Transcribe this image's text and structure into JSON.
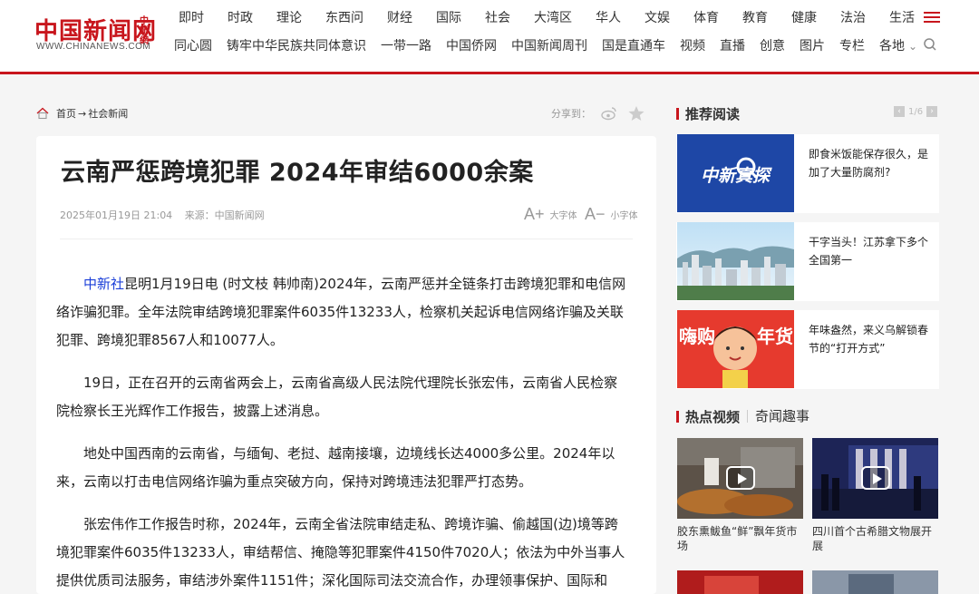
{
  "logo": {
    "main": "中国新闻网",
    "small": "中新網",
    "url": "WWW.CHINANEWS.COM"
  },
  "nav": {
    "row1": [
      "即时",
      "时政",
      "理论",
      "东西问",
      "财经",
      "国际",
      "社会",
      "大湾区",
      "华人",
      "文娱",
      "体育",
      "教育",
      "健康",
      "法治",
      "生活"
    ],
    "row2": [
      "同心圆",
      "铸牢中华民族共同体意识",
      "一带一路",
      "中国侨网",
      "中国新闻周刊",
      "国是直通车",
      "视频",
      "直播",
      "创意",
      "图片",
      "专栏",
      "各地"
    ],
    "menu_icon": "hamburger-icon",
    "search_icon": "search-icon"
  },
  "breadcrumb": {
    "home": "首页",
    "sep": "→",
    "section": "社会新闻"
  },
  "share": {
    "label": "分享到：",
    "icons": [
      "weibo-icon",
      "star-icon"
    ]
  },
  "article": {
    "title": "云南严惩跨境犯罪 2024年审结6000余案",
    "date": "2025年01月19日 21:04",
    "source": "来源：中国新闻网",
    "font_big": "大字体",
    "font_small": "小字体",
    "p1_link": "中新社",
    "p1": "昆明1月19日电 (时文枝 韩帅南)2024年，云南严惩并全链条打击跨境犯罪和电信网络诈骗犯罪。全年法院审结跨境犯罪案件6035件13233人，检察机关起诉电信网络诈骗及关联犯罪、跨境犯罪8567人和10077人。",
    "p2": "19日，正在召开的云南省两会上，云南省高级人民法院代理院长张宏伟，云南省人民检察院检察长王光辉作工作报告，披露上述消息。",
    "p3": "地处中国西南的云南省，与缅甸、老挝、越南接壤，边境线长达4000多公里。2024年以来，云南以打击电信网络诈骗为重点突破方向，保持对跨境违法犯罪严打态势。",
    "p4": "张宏伟作工作报告时称，2024年，云南全省法院审结走私、跨境诈骗、偷越国(边)境等跨境犯罪案件6035件13233人，审结帮信、掩隐等犯罪案件4150件7020人；依法为中外当事人提供优质司法服务，审结涉外案件1151件；深化国际司法交流合作，办理领事保护、国际和"
  },
  "sidebar": {
    "recommend_title": "推荐阅读",
    "pager": "1/6",
    "recommend": [
      {
        "text": "即食米饭能保存很久，是加了大量防腐剂?",
        "thumb": "中新真探"
      },
      {
        "text": "干字当头！江苏拿下多个全国第一",
        "thumb": ""
      },
      {
        "text": "年味盎然，来义乌解锁春节的“打开方式”",
        "thumb_left": "嗨购",
        "thumb_right": "年货"
      }
    ],
    "video_tab1": "热点视频",
    "video_tab2": "奇闻趣事",
    "videos": [
      {
        "text": "胶东熏鲅鱼“鲜”飘年货市场"
      },
      {
        "text": "四川首个古希腊文物展开展"
      }
    ]
  }
}
